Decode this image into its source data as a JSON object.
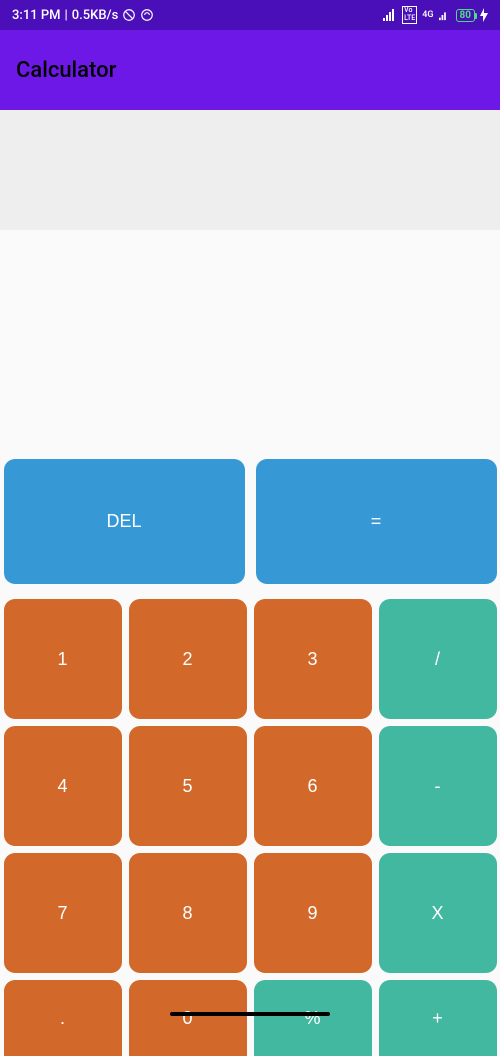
{
  "status_bar": {
    "time": "3:11 PM",
    "data_rate": "0.5KB/s",
    "battery": "80"
  },
  "app": {
    "title": "Calculator"
  },
  "buttons": {
    "del": "DEL",
    "equals": "=",
    "n1": "1",
    "n2": "2",
    "n3": "3",
    "n4": "4",
    "n5": "5",
    "n6": "6",
    "n7": "7",
    "n8": "8",
    "n9": "9",
    "n0": "0",
    "dot": ".",
    "divide": "/",
    "minus": "-",
    "multiply": "X",
    "percent": "%",
    "plus": "+"
  }
}
